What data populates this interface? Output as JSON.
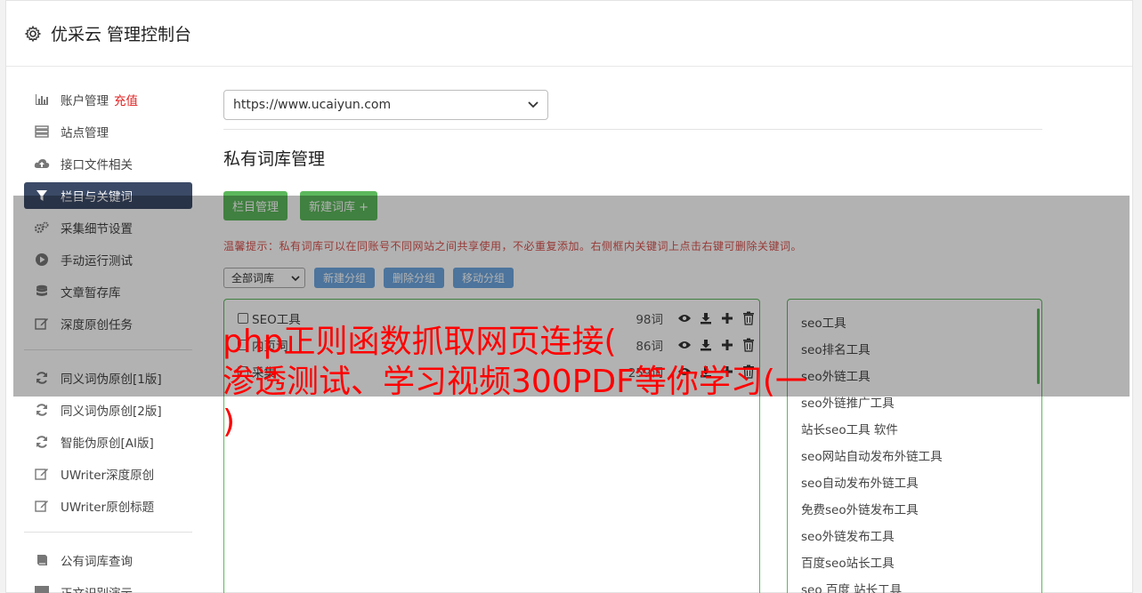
{
  "header": {
    "title": "优采云 管理控制台",
    "icon": "gear-icon"
  },
  "sidebar": {
    "items": [
      {
        "label": "账户管理",
        "badge": "充值",
        "icon": "bar-chart-icon"
      },
      {
        "label": "站点管理",
        "icon": "server-icon"
      },
      {
        "label": "接口文件相关",
        "icon": "cloud-upload-icon"
      },
      {
        "label": "栏目与关键词",
        "icon": "filter-icon",
        "active": true
      },
      {
        "label": "采集细节设置",
        "icon": "cogs-icon"
      },
      {
        "label": "手动运行测试",
        "icon": "play-circle-icon"
      },
      {
        "label": "文章暂存库",
        "icon": "database-icon"
      },
      {
        "label": "深度原创任务",
        "icon": "edit-icon"
      }
    ],
    "items2": [
      {
        "label": "同义词伪原创[1版]",
        "icon": "refresh-icon"
      },
      {
        "label": "同义词伪原创[2版]",
        "icon": "refresh-icon"
      },
      {
        "label": "智能伪原创[AI版]",
        "icon": "refresh-icon"
      },
      {
        "label": "UWriter深度原创",
        "icon": "edit-icon"
      },
      {
        "label": "UWriter原创标题",
        "icon": "edit-icon"
      }
    ],
    "items3": [
      {
        "label": "公有词库查询",
        "icon": "book-icon"
      },
      {
        "label": "正文识别演示",
        "icon": "monitor-icon"
      }
    ]
  },
  "main": {
    "site_select": "https://www.ucaiyun.com",
    "section_title": "私有词库管理",
    "btn_column": "栏目管理",
    "btn_new_lib": "新建词库 +",
    "tip": "温馨提示：私有词库可以在同账号不同网站之间共享使用，不必重复添加。右侧框内关键词上点击右键可删除关键词。",
    "group_select": "全部词库",
    "btn_new_group": "新建分组",
    "btn_delete_group": "删除分组",
    "btn_move_group": "移动分组",
    "groups": [
      {
        "name": "SEO工具",
        "count": "98词"
      },
      {
        "name": "内页词",
        "count": "86词"
      },
      {
        "name": "采集",
        "count": "259词"
      }
    ],
    "keywords": [
      "seo工具",
      "seo排名工具",
      "seo外链工具",
      "seo外链推广工具",
      "站长seo工具 软件",
      "seo网站自动发布外链工具",
      "seo自动发布外链工具",
      "免费seo外链发布工具",
      "seo外链发布工具",
      "百度seo站长工具",
      "seo 百度 站长工具"
    ]
  },
  "headline": {
    "line1": "php正则函数抓取网页连接(",
    "line2": "渗透测试、学习视频300PDF等你学习(一",
    "line3": ")"
  }
}
